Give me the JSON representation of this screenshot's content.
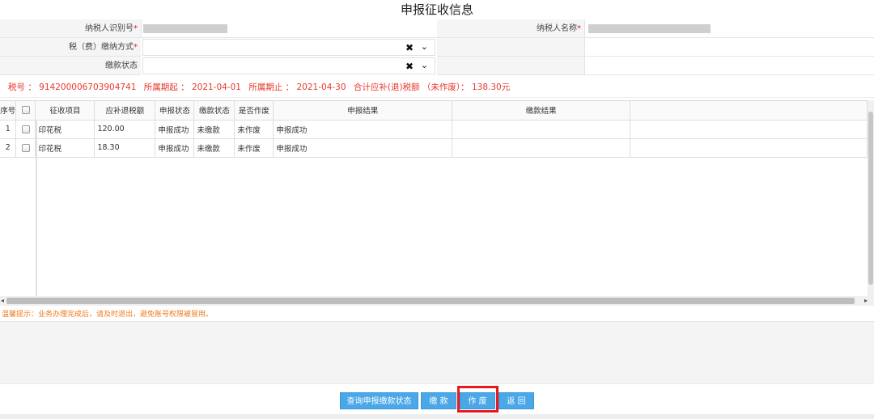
{
  "title": "申报征收信息",
  "form": {
    "taxpayer_id_label": "纳税人识别号",
    "taxpayer_name_label": "纳税人名称",
    "payment_method_label": "税（费）缴纳方式",
    "payment_status_label": "缴款状态",
    "required_mark": "*",
    "clear_glyph": "✖",
    "dropdown_glyph": "⌄"
  },
  "summary": {
    "tax_no": "税号 ： 914200006703904741",
    "period_start": "所属期起 ： 2021-04-01",
    "period_end": "所属期止 ： 2021-04-30",
    "total": "合计应补(退)税额 （未作废）： 138.30元"
  },
  "table": {
    "columns": [
      "序号",
      "",
      "征收项目",
      "应补退税额",
      "申报状态",
      "缴款状态",
      "是否作废",
      "申报结果",
      "缴款结果"
    ],
    "rows": [
      {
        "no": "1",
        "item": "印花税",
        "amount": "120.00",
        "declare_status": "申报成功",
        "pay_status": "未缴款",
        "voided": "未作废",
        "declare_result": "申报成功",
        "pay_result": ""
      },
      {
        "no": "2",
        "item": "印花税",
        "amount": "18.30",
        "declare_status": "申报成功",
        "pay_status": "未缴款",
        "voided": "未作废",
        "declare_result": "申报成功",
        "pay_result": ""
      }
    ]
  },
  "tip": "温馨提示：业务办理完成后，请及时退出，避免账号权限被冒用。",
  "buttons": {
    "query_status": "查询申报缴款状态",
    "pay": "缴 款",
    "void": "作 废",
    "back": "返 回"
  },
  "colors": {
    "accent_button": "#4aa7e8",
    "summary_text": "#e8382c",
    "tip_text": "#f07a1a",
    "highlight_box": "#e8191f"
  },
  "icons": {
    "clear": "clear-icon",
    "dropdown": "chevron-down-icon",
    "scroll_left": "scroll-left-arrow-icon",
    "scroll_right": "scroll-right-arrow-icon"
  }
}
